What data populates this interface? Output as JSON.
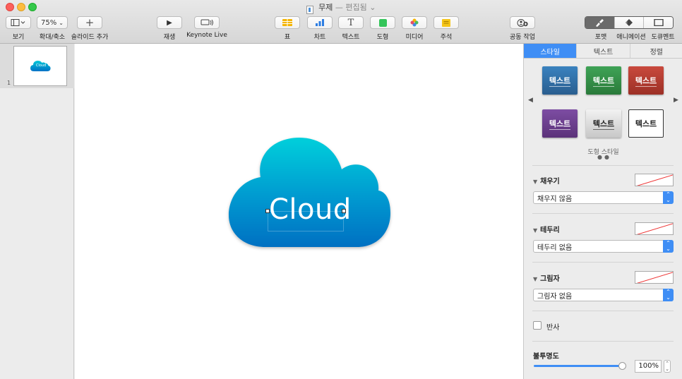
{
  "window": {
    "title": "무제",
    "separator": "—",
    "status": "편집됨",
    "status_chevron": "⌄"
  },
  "toolbar": {
    "view_label": "보기",
    "zoom_value": "75%",
    "zoom_label": "확대/축소",
    "add_slide_label": "슬라이드 추가",
    "play_label": "재생",
    "keynote_live_label": "Keynote Live",
    "table_label": "표",
    "chart_label": "차트",
    "text_label": "텍스트",
    "shape_label": "도형",
    "media_label": "미디어",
    "comment_label": "주석",
    "collaborate_label": "공동 작업",
    "format_label": "포맷",
    "animate_label": "애니메이션",
    "document_label": "도큐멘트"
  },
  "navigator": {
    "slide_number": "1",
    "thumb_text": "Cloud"
  },
  "canvas": {
    "cloud_text": "Cloud",
    "cloud_gradient_top": "#00c8d8",
    "cloud_gradient_bottom": "#0072c6"
  },
  "inspector": {
    "tabs": [
      "스타일",
      "텍스트",
      "정렬"
    ],
    "style_presets": [
      {
        "label": "텍스트",
        "color": "#2f6fa5"
      },
      {
        "label": "텍스트",
        "color": "#2e8a3f"
      },
      {
        "label": "텍스트",
        "color": "#b23b2f"
      },
      {
        "label": "텍스트",
        "color": "#6a3c8d"
      },
      {
        "label": "텍스트",
        "color": "#d9d9d9"
      },
      {
        "label": "텍스트",
        "color": "#ffffff"
      }
    ],
    "shape_styles_caption": "도형 스타일",
    "fill": {
      "label": "채우기",
      "value": "채우지 않음"
    },
    "border": {
      "label": "테두리",
      "value": "테두리 없음"
    },
    "shadow": {
      "label": "그림자",
      "value": "그림자 없음"
    },
    "reflection_label": "반사",
    "opacity": {
      "label": "불투명도",
      "value": "100%",
      "level": 1.0
    }
  }
}
